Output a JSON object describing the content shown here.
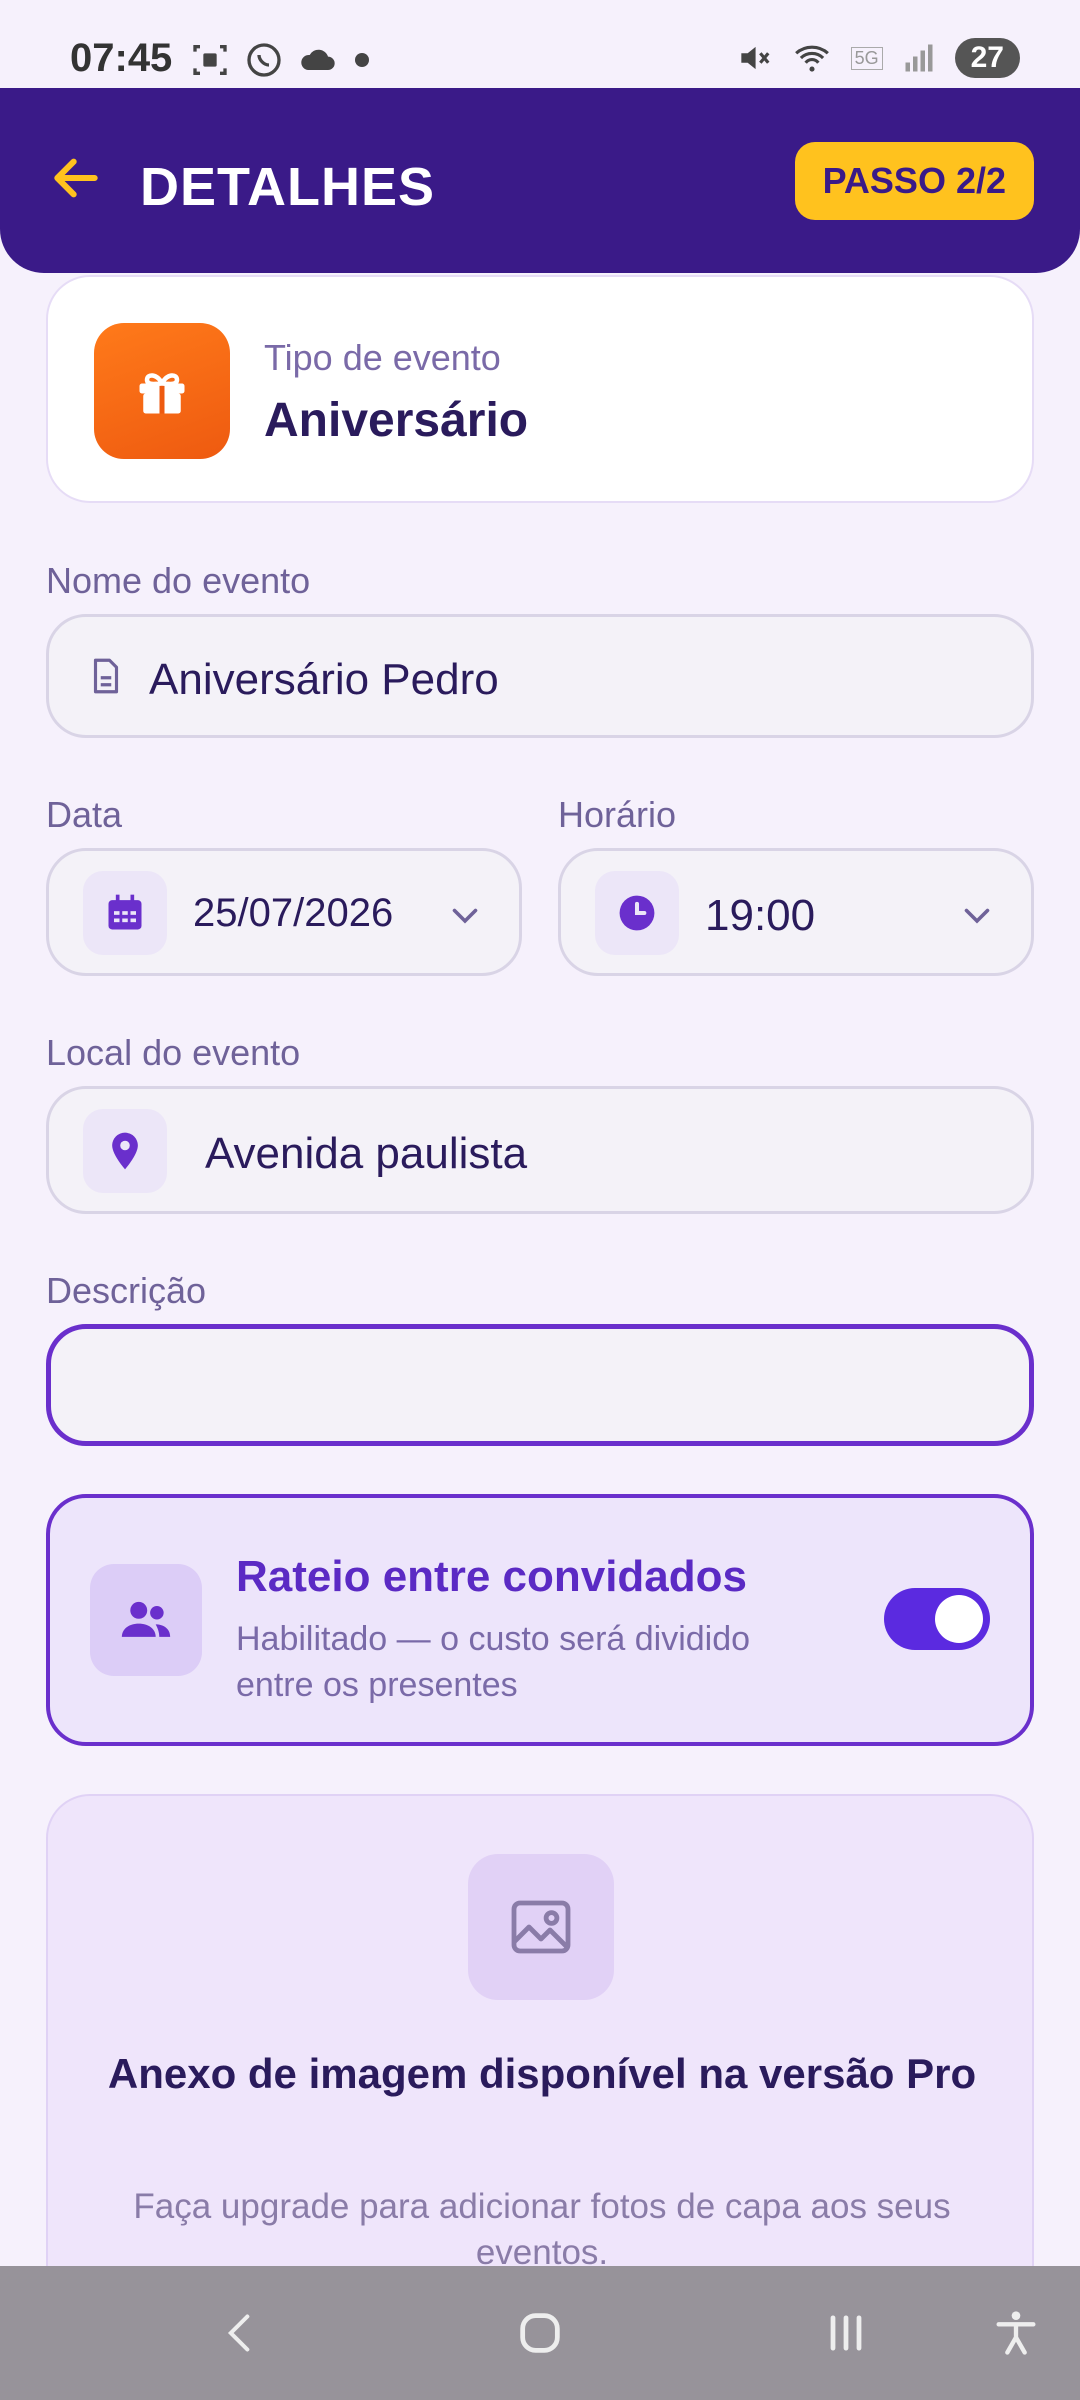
{
  "status_bar": {
    "time": "07:45",
    "battery": "27",
    "network": "5G"
  },
  "header": {
    "title": "DETALHES",
    "step": "PASSO 2/2",
    "colors": {
      "background": "#3a1a88",
      "accent": "#ffc21e"
    }
  },
  "event_type": {
    "label": "Tipo de evento",
    "value": "Aniversário",
    "icon": "gift-icon"
  },
  "form": {
    "name": {
      "label": "Nome do evento",
      "value": "Aniversário Pedro"
    },
    "date": {
      "label": "Data",
      "value": "25/07/2026"
    },
    "time": {
      "label": "Horário",
      "value": "19:00"
    },
    "location": {
      "label": "Local do evento",
      "value": "Avenida paulista"
    },
    "description": {
      "label": "Descrição",
      "value": ""
    }
  },
  "rateio": {
    "title": "Rateio entre convidados",
    "subtitle": "Habilitado — o custo será dividido entre os presentes",
    "enabled": true
  },
  "pro": {
    "title": "Anexo de imagem disponível na versão Pro",
    "subtitle": "Faça upgrade para adicionar fotos de capa aos seus eventos."
  },
  "nav": {
    "buttons": [
      "back-icon",
      "home-icon",
      "recents-icon",
      "accessibility-icon"
    ]
  }
}
